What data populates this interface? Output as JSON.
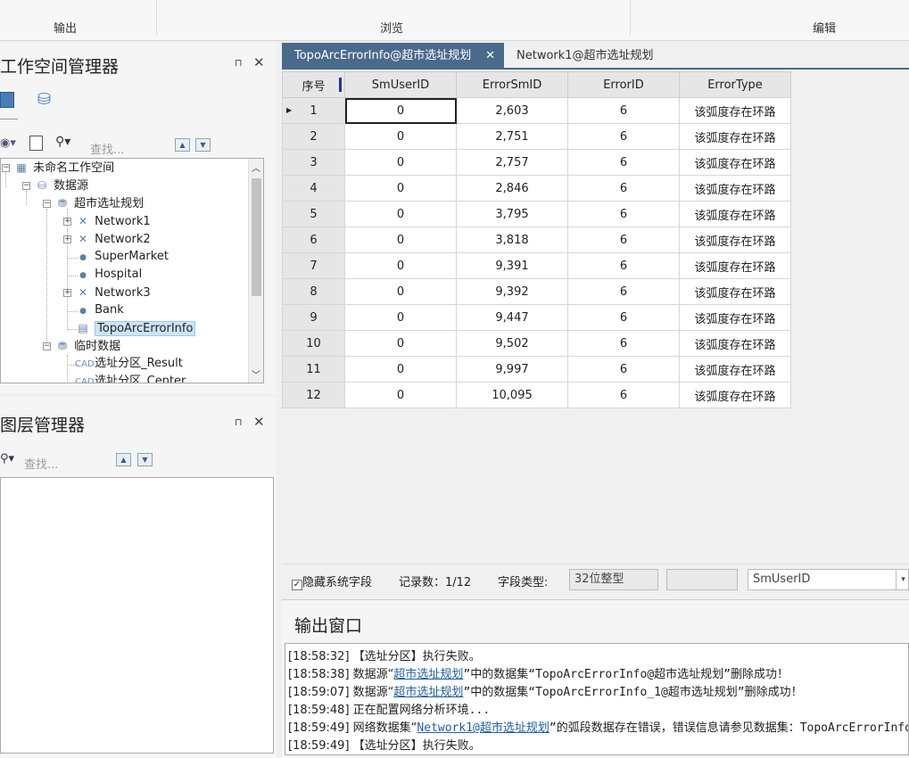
{
  "ribbon": {
    "groups": [
      "输出",
      "浏览",
      "编辑"
    ]
  },
  "workspace": {
    "title": "工作空间管理器",
    "search_placeholder": "查找...",
    "tree": {
      "root": "未命名工作空间",
      "datasources": "数据源",
      "datasource": "超市选址规划",
      "items": [
        "Network1",
        "Network2",
        "SuperMarket",
        "Hospital",
        "Network3",
        "Bank",
        "TopoArcErrorInfo"
      ],
      "temp": "临时数据",
      "temp_items": [
        "选址分区_Result",
        "选址分区_Center"
      ]
    }
  },
  "layers": {
    "title": "图层管理器",
    "search_placeholder": "查找..."
  },
  "tabs": [
    {
      "label": "TopoArcErrorInfo@超市选址规划",
      "close": "✕"
    },
    {
      "label": "Network1@超市选址规划"
    }
  ],
  "grid": {
    "columns": [
      "序号",
      "SmUserID",
      "ErrorSmID",
      "ErrorID",
      "ErrorType"
    ],
    "rows": [
      [
        "1",
        "0",
        "2,603",
        "6",
        "该弧度存在环路"
      ],
      [
        "2",
        "0",
        "2,751",
        "6",
        "该弧度存在环路"
      ],
      [
        "3",
        "0",
        "2,757",
        "6",
        "该弧度存在环路"
      ],
      [
        "4",
        "0",
        "2,846",
        "6",
        "该弧度存在环路"
      ],
      [
        "5",
        "0",
        "3,795",
        "6",
        "该弧度存在环路"
      ],
      [
        "6",
        "0",
        "3,818",
        "6",
        "该弧度存在环路"
      ],
      [
        "7",
        "0",
        "9,391",
        "6",
        "该弧度存在环路"
      ],
      [
        "8",
        "0",
        "9,392",
        "6",
        "该弧度存在环路"
      ],
      [
        "9",
        "0",
        "9,447",
        "6",
        "该弧度存在环路"
      ],
      [
        "10",
        "0",
        "9,502",
        "6",
        "该弧度存在环路"
      ],
      [
        "11",
        "0",
        "9,997",
        "6",
        "该弧度存在环路"
      ],
      [
        "12",
        "0",
        "10,095",
        "6",
        "该弧度存在环路"
      ]
    ]
  },
  "status": {
    "hide_system_fields": "隐藏系统字段",
    "record_count": "记录数：1/12",
    "field_type_label": "字段类型:",
    "field_type": "32位整型",
    "field_name": "SmUserID"
  },
  "output": {
    "title": "输出窗口",
    "lines": [
      {
        "time": "[18:58:32]",
        "parts": [
          "【选址分区】执行失败。"
        ]
      },
      {
        "time": "[18:58:38]",
        "pre": "数据源“",
        "link": "超市选址规划",
        "post": "”中的数据集“TopoArcErrorInfo@超市选址规划”删除成功！"
      },
      {
        "time": "[18:59:07]",
        "pre": "数据源“",
        "link": "超市选址规划",
        "post": "”中的数据集“TopoArcErrorInfo_1@超市选址规划”删除成功！"
      },
      {
        "time": "[18:59:48]",
        "parts": [
          "正在配置网络分析环境..."
        ]
      },
      {
        "time": "[18:59:49]",
        "pre": "网络数据集“",
        "link": "Network1@超市选址规划",
        "post": "”的弧段数据存在错误，错误信息请参见数据集：TopoArcErrorInfo"
      },
      {
        "time": "[18:59:49]",
        "parts": [
          "【选址分区】执行失败。"
        ]
      }
    ]
  }
}
